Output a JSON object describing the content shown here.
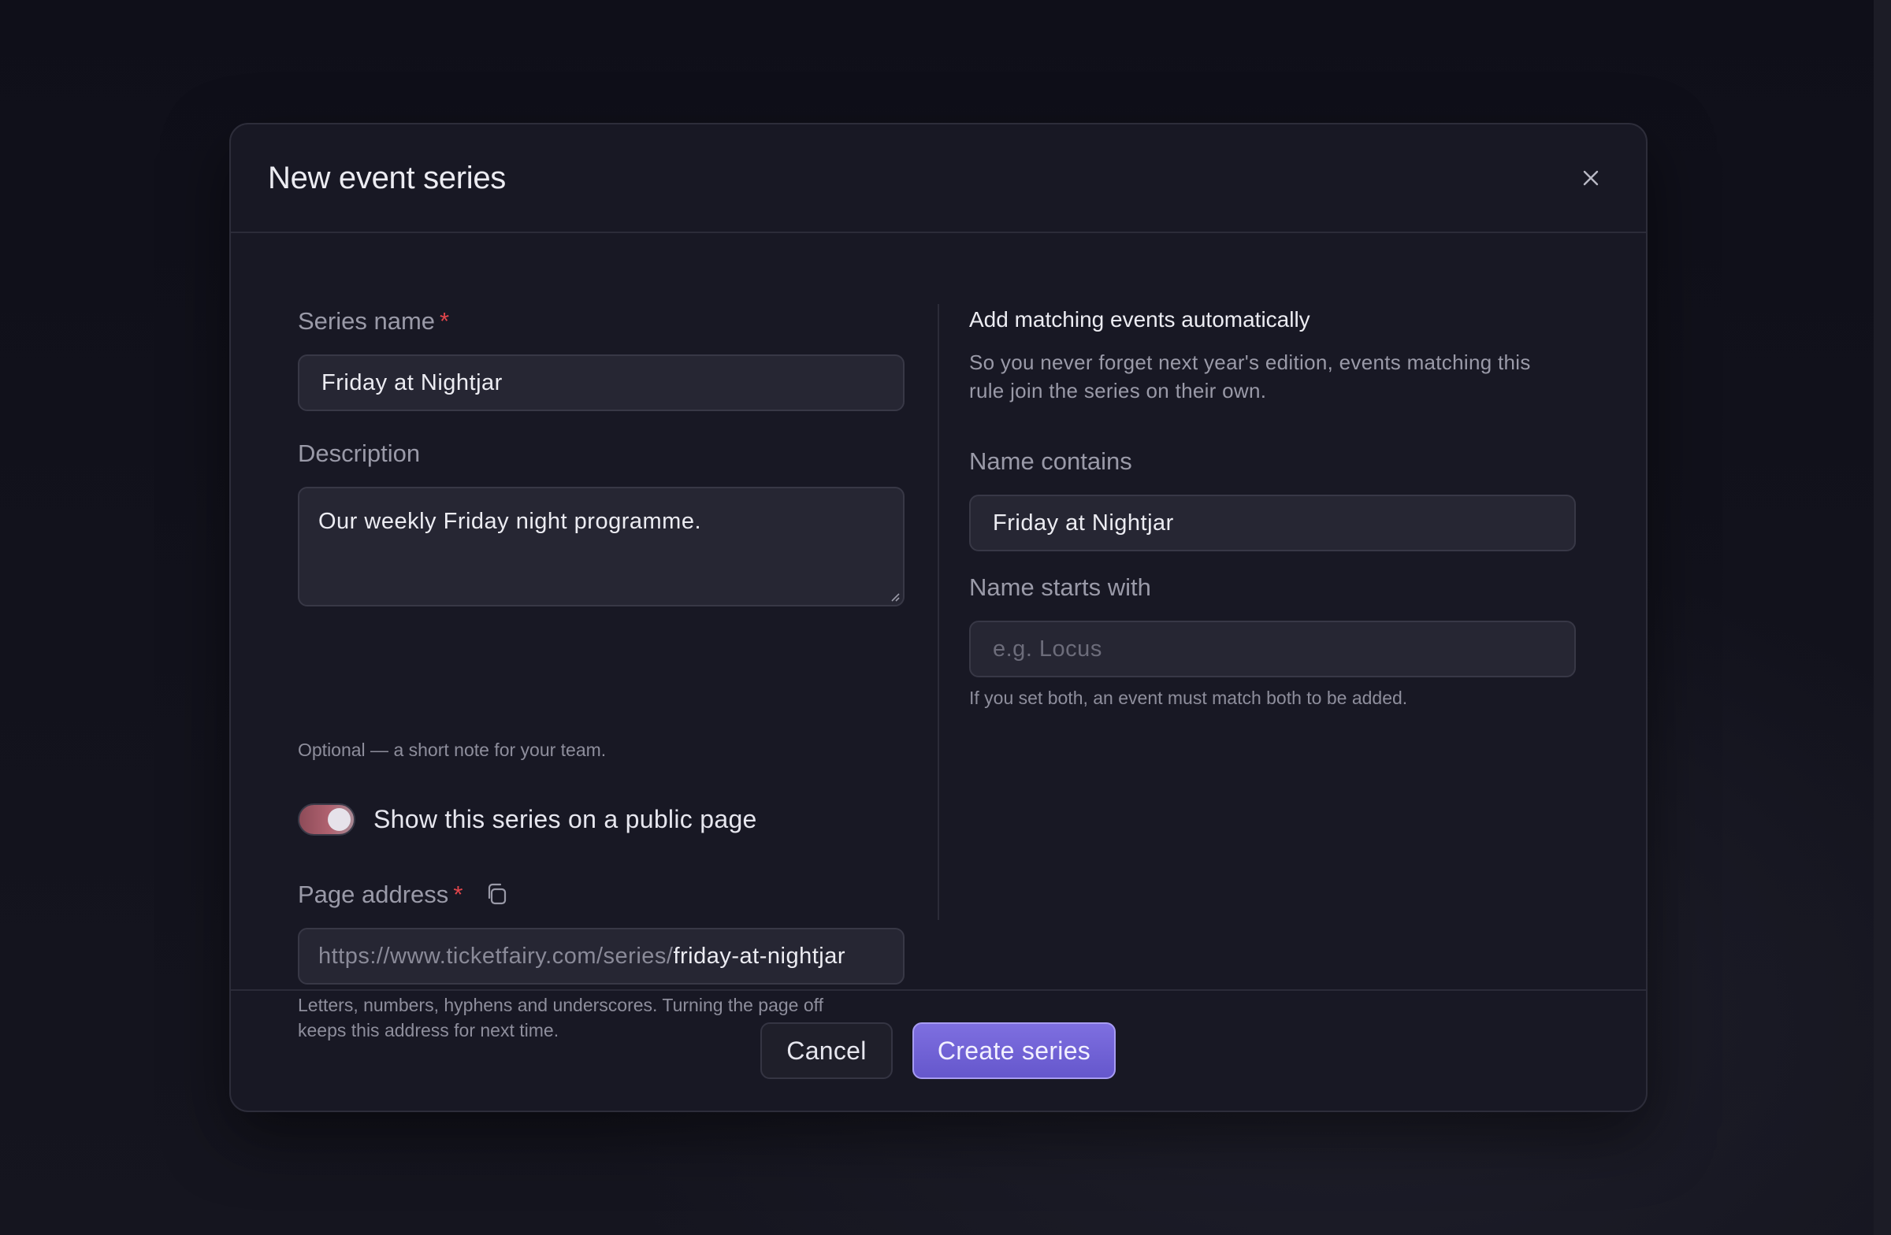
{
  "modal": {
    "title": "New event series",
    "close_icon": "close-icon"
  },
  "form": {
    "series_name": {
      "label": "Series name",
      "required_mark": "*",
      "value": "Friday at Nightjar"
    },
    "description": {
      "label": "Description",
      "value": "Our weekly Friday night programme.",
      "hint": "Optional — a short note for your team."
    },
    "public_page_toggle": {
      "label": "Show this series on a public page",
      "on": true
    },
    "page_address": {
      "label": "Page address",
      "required_mark": "*",
      "copy_icon": "copy-icon",
      "prefix": "https://www.ticketfairy.com/series/",
      "slug": "friday-at-nightjar",
      "hint_line1": "Letters, numbers, hyphens and underscores. Turning the page off",
      "hint_line2": "keeps this address for next time."
    }
  },
  "auto_match": {
    "title": "Add matching events automatically",
    "description_line1": "So you never forget next year's edition, events matching this",
    "description_line2": "rule join the series on their own.",
    "name_contains": {
      "label": "Name contains",
      "value": "Friday at Nightjar"
    },
    "name_starts_with": {
      "label": "Name starts with",
      "placeholder": "e.g. Locus"
    },
    "hint": "If you set both, an event must match both to be added."
  },
  "footer": {
    "cancel_label": "Cancel",
    "create_label": "Create series"
  },
  "colors": {
    "accent": "#6f61d6",
    "required": "#e0454b",
    "background": "#12121c",
    "modal": "#181824"
  }
}
